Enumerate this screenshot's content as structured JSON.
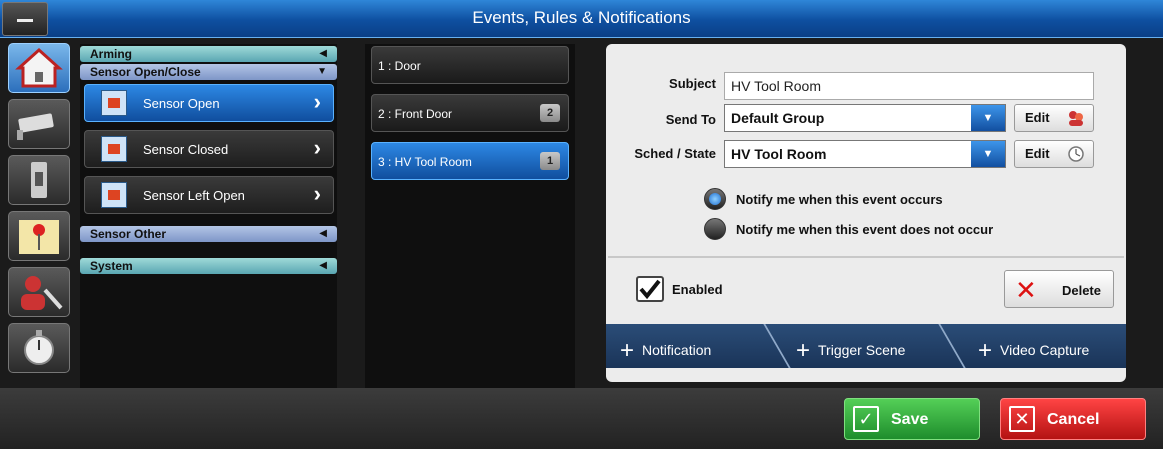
{
  "window": {
    "title": "Events, Rules & Notifications"
  },
  "rail_icons": [
    "home-security-icon",
    "camera-icon",
    "switch-icon",
    "map-pin-icon",
    "user-tools-icon",
    "stopwatch-icon"
  ],
  "categories": {
    "arming": "Arming",
    "sensor_open_close": "Sensor Open/Close",
    "events": [
      {
        "label": "Sensor Open"
      },
      {
        "label": "Sensor Closed"
      },
      {
        "label": "Sensor Left Open"
      }
    ],
    "sensor_other": "Sensor Other",
    "system": "System"
  },
  "rules": [
    {
      "label": "1 : Door",
      "count": ""
    },
    {
      "label": "2 : Front Door",
      "count": "2"
    },
    {
      "label": "3 : HV Tool Room",
      "count": "1"
    }
  ],
  "detail": {
    "subject_label": "Subject",
    "subject_value": "HV Tool Room",
    "send_to_label": "Send To",
    "send_to_value": "Default Group",
    "sched_label": "Sched / State",
    "sched_value": "HV Tool Room",
    "edit_label": "Edit",
    "notify_occurs": "Notify me when this event occurs",
    "notify_not_occur": "Notify me when this event does not occur",
    "enabled_label": "Enabled",
    "delete_label": "Delete"
  },
  "tabs": [
    {
      "label": "Notification"
    },
    {
      "label": "Trigger Scene"
    },
    {
      "label": "Video Capture"
    }
  ],
  "footer": {
    "save": "Save",
    "cancel": "Cancel"
  },
  "colors": {
    "accent": "#1f6fd0",
    "save": "#2aa33a",
    "cancel": "#d32020"
  }
}
